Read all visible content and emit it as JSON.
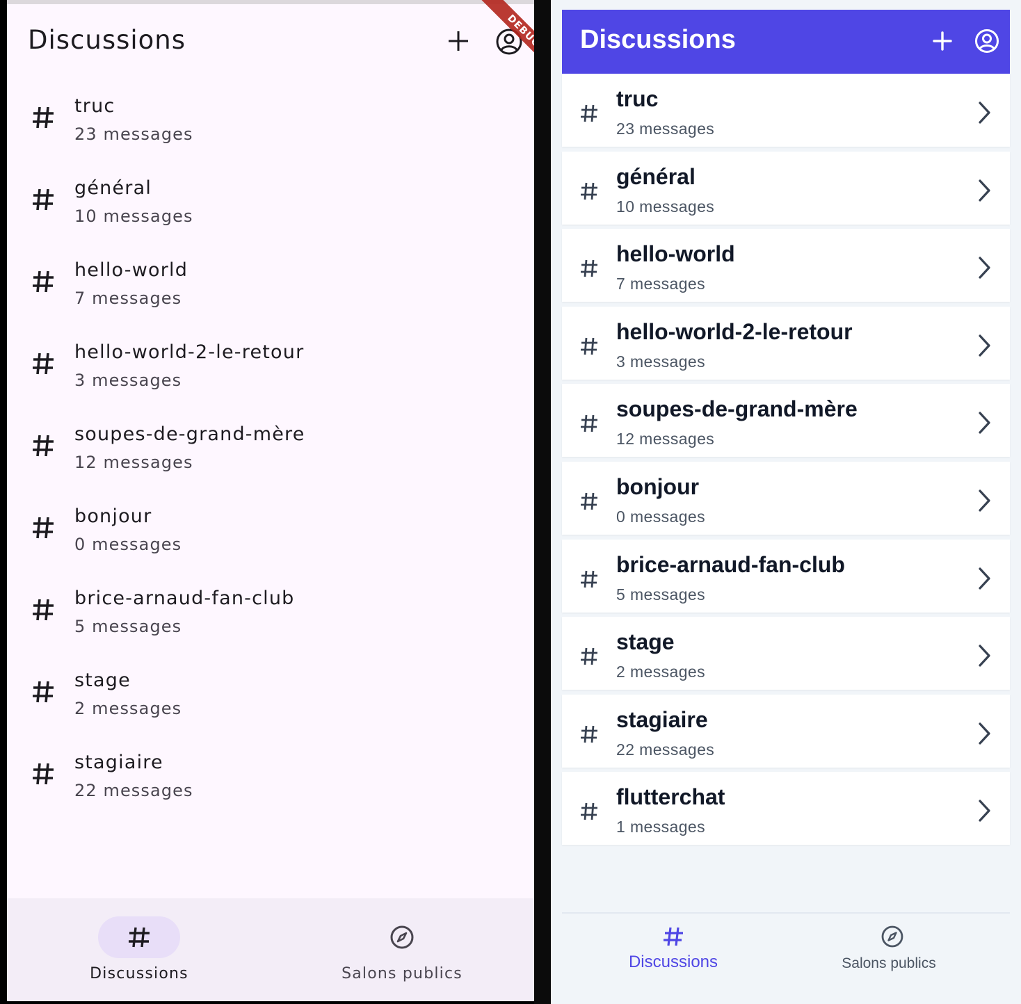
{
  "material_app": {
    "title": "Discussions",
    "debug_banner": "DEBUG",
    "actions": {
      "add_icon": "plus-icon",
      "account_icon": "account-circle-icon"
    },
    "channels": [
      {
        "name": "truc",
        "count": "23 messages"
      },
      {
        "name": "général",
        "count": "10 messages"
      },
      {
        "name": "hello-world",
        "count": "7 messages"
      },
      {
        "name": "hello-world-2-le-retour",
        "count": "3 messages"
      },
      {
        "name": "soupes-de-grand-mère",
        "count": "12 messages"
      },
      {
        "name": "bonjour",
        "count": "0 messages"
      },
      {
        "name": "brice-arnaud-fan-club",
        "count": "5 messages"
      },
      {
        "name": "stage",
        "count": "2 messages"
      },
      {
        "name": "stagiaire",
        "count": "22 messages"
      }
    ],
    "nav": [
      {
        "label": "Discussions",
        "icon": "hashtag-icon",
        "active": true
      },
      {
        "label": "Salons publics",
        "icon": "compass-icon",
        "active": false
      }
    ],
    "colors": {
      "background": "#fef7ff",
      "nav_background": "#f3edf7",
      "indicator": "#e8def8",
      "text": "#1d1b20",
      "banner": "#b3261e"
    }
  },
  "tailwind_app": {
    "title": "Discussions",
    "actions": {
      "add_icon": "plus-icon",
      "account_icon": "account-circle-icon"
    },
    "channels": [
      {
        "name": "truc",
        "count": "23 messages"
      },
      {
        "name": "général",
        "count": "10 messages"
      },
      {
        "name": "hello-world",
        "count": "7 messages"
      },
      {
        "name": "hello-world-2-le-retour",
        "count": "3 messages"
      },
      {
        "name": "soupes-de-grand-mère",
        "count": "12 messages"
      },
      {
        "name": "bonjour",
        "count": "0 messages"
      },
      {
        "name": "brice-arnaud-fan-club",
        "count": "5 messages"
      },
      {
        "name": "stage",
        "count": "2 messages"
      },
      {
        "name": "stagiaire",
        "count": "22 messages"
      },
      {
        "name": "flutterchat",
        "count": "1 messages"
      }
    ],
    "nav": [
      {
        "label": "Discussions",
        "icon": "hashtag-icon",
        "active": true
      },
      {
        "label": "Salons publics",
        "icon": "compass-icon",
        "active": false
      }
    ],
    "colors": {
      "header": "#4f46e5",
      "background": "#f1f5f9",
      "card": "#ffffff",
      "active_nav": "#4f46e5",
      "muted": "#4b5563"
    }
  }
}
